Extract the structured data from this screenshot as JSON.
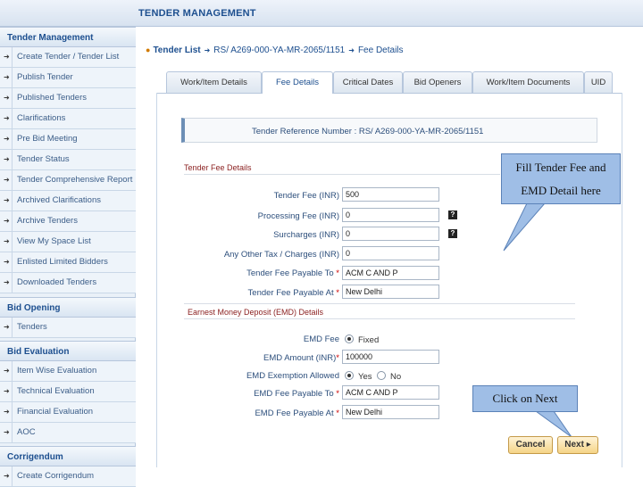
{
  "header": {
    "title": "TENDER MANAGEMENT"
  },
  "sidebar": {
    "tender_management": {
      "heading": "Tender Management",
      "items": [
        {
          "label": "Create Tender / Tender List"
        },
        {
          "label": "Publish Tender"
        },
        {
          "label": "Published Tenders"
        },
        {
          "label": "Clarifications"
        },
        {
          "label": "Pre Bid Meeting"
        },
        {
          "label": "Tender Status"
        },
        {
          "label": "Tender Comprehensive Report"
        },
        {
          "label": "Archived Clarifications"
        },
        {
          "label": "Archive Tenders"
        },
        {
          "label": "View My Space List"
        },
        {
          "label": "Enlisted Limited Bidders"
        },
        {
          "label": "Downloaded Tenders"
        }
      ]
    },
    "bid_opening": {
      "heading": "Bid Opening",
      "items": [
        {
          "label": "Tenders"
        }
      ]
    },
    "bid_evaluation": {
      "heading": "Bid Evaluation",
      "items": [
        {
          "label": "Item Wise Evaluation"
        },
        {
          "label": "Technical Evaluation"
        },
        {
          "label": "Financial Evaluation"
        },
        {
          "label": "AOC"
        }
      ]
    },
    "corrigendum": {
      "heading": "Corrigendum",
      "items": [
        {
          "label": "Create Corrigendum"
        }
      ]
    }
  },
  "breadcrumb": {
    "tender_list": "Tender List",
    "reference": "RS/ A269-000-YA-MR-2065/1151",
    "current": "Fee Details"
  },
  "tabs": [
    {
      "label": "Work/Item Details"
    },
    {
      "label": "Fee Details",
      "active": true
    },
    {
      "label": "Critical Dates"
    },
    {
      "label": "Bid Openers"
    },
    {
      "label": "Work/Item Documents"
    },
    {
      "label": "UID"
    }
  ],
  "reference": {
    "label": "Tender Reference Number : RS/ A269-000-YA-MR-2065/1151"
  },
  "tender_fee": {
    "section_title": "Tender Fee Details",
    "fields": {
      "tender_fee": {
        "label": "Tender Fee (INR)",
        "value": "500"
      },
      "processing_fee": {
        "label": "Processing Fee (INR)",
        "value": "0"
      },
      "surcharges": {
        "label": "Surcharges (INR)",
        "value": "0"
      },
      "other_tax": {
        "label": "Any Other Tax / Charges (INR)",
        "value": "0"
      },
      "payable_to": {
        "label": "Tender Fee Payable To",
        "value": "ACM C AND P"
      },
      "payable_at": {
        "label": "Tender Fee Payable At",
        "value": "New Delhi"
      }
    },
    "help_icon": "?"
  },
  "emd": {
    "section_title": "Earnest Money Deposit (EMD) Details",
    "emd_fee": {
      "label": "EMD Fee",
      "option": "Fixed"
    },
    "emd_amount": {
      "label": "EMD Amount (INR)",
      "value": "100000"
    },
    "exemption": {
      "label": "EMD Exemption Allowed",
      "yes": "Yes",
      "no": "No",
      "selected": "Yes"
    },
    "payable_to": {
      "label": "EMD Fee Payable To",
      "value": "ACM C AND P"
    },
    "payable_at": {
      "label": "EMD Fee Payable At",
      "value": "New Delhi"
    }
  },
  "required_mark": "*",
  "callouts": {
    "fee_line1": "Fill Tender Fee and",
    "fee_line2": "EMD Detail here",
    "next": "Click on Next"
  },
  "buttons": {
    "cancel": "Cancel",
    "next": "Next"
  }
}
